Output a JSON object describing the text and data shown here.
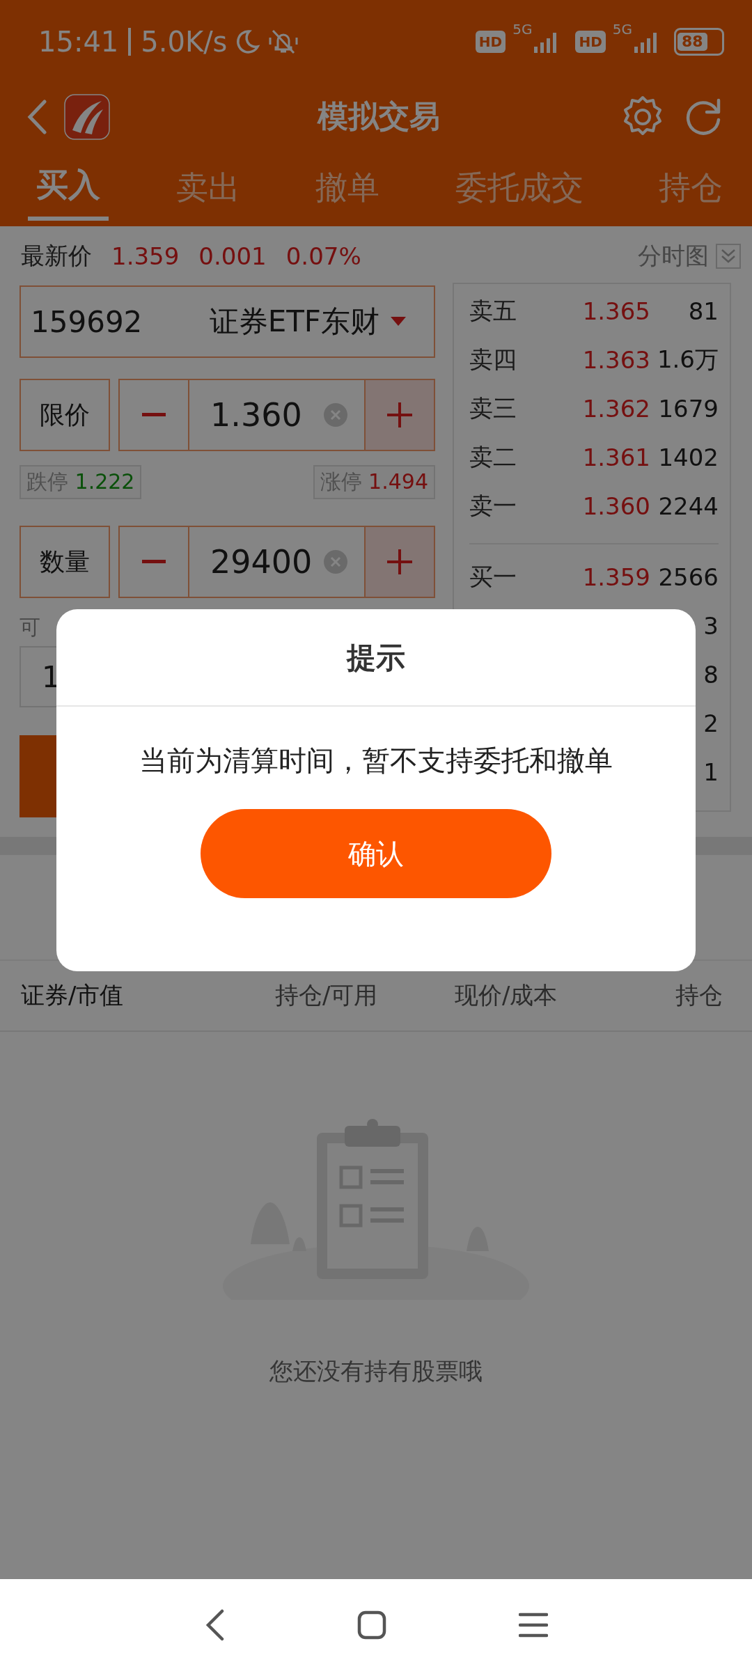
{
  "status_bar": {
    "time": "15:41",
    "speed": "5.0K/s",
    "sims": [
      {
        "badge": "HD",
        "network": "5G"
      },
      {
        "badge": "HD",
        "network": "5G"
      }
    ],
    "battery": "88"
  },
  "header": {
    "title": "模拟交易"
  },
  "tabs": [
    {
      "label": "买入",
      "selected": true
    },
    {
      "label": "卖出",
      "selected": false
    },
    {
      "label": "撤单",
      "selected": false
    },
    {
      "label": "委托成交",
      "selected": false
    },
    {
      "label": "持仓",
      "selected": false
    }
  ],
  "quote": {
    "label": "最新价",
    "price": "1.359",
    "change": "0.001",
    "change_pct": "0.07%",
    "chart_link": "分时图"
  },
  "stock": {
    "code": "159692",
    "name": "证券ETF东财"
  },
  "price_input": {
    "label": "限价",
    "value": "1.360"
  },
  "limits": {
    "down_label": "跌停",
    "down": "1.222",
    "up_label": "涨停",
    "up": "1.494"
  },
  "quantity_input": {
    "label": "数量",
    "value": "29400"
  },
  "available": {
    "label": "可",
    "value": "1"
  },
  "order_book": {
    "asks": [
      {
        "label": "卖五",
        "price": "1.365",
        "volume": "81"
      },
      {
        "label": "卖四",
        "price": "1.363",
        "volume": "1.6万"
      },
      {
        "label": "卖三",
        "price": "1.362",
        "volume": "1679"
      },
      {
        "label": "卖二",
        "price": "1.361",
        "volume": "1402"
      },
      {
        "label": "卖一",
        "price": "1.360",
        "volume": "2244"
      }
    ],
    "bids": [
      {
        "label": "买一",
        "price": "1.359",
        "volume": "2566"
      },
      {
        "volume": "3"
      },
      {
        "volume": "8"
      },
      {
        "volume": "2"
      },
      {
        "volume": "1"
      }
    ]
  },
  "positions": {
    "columns": [
      "证券/市值",
      "持仓/可用",
      "现价/成本",
      "持仓"
    ],
    "empty_text": "您还没有持有股票哦"
  },
  "dialog": {
    "title": "提示",
    "message": "当前为清算时间，暂不支持委托和撤单",
    "button": "确认"
  }
}
